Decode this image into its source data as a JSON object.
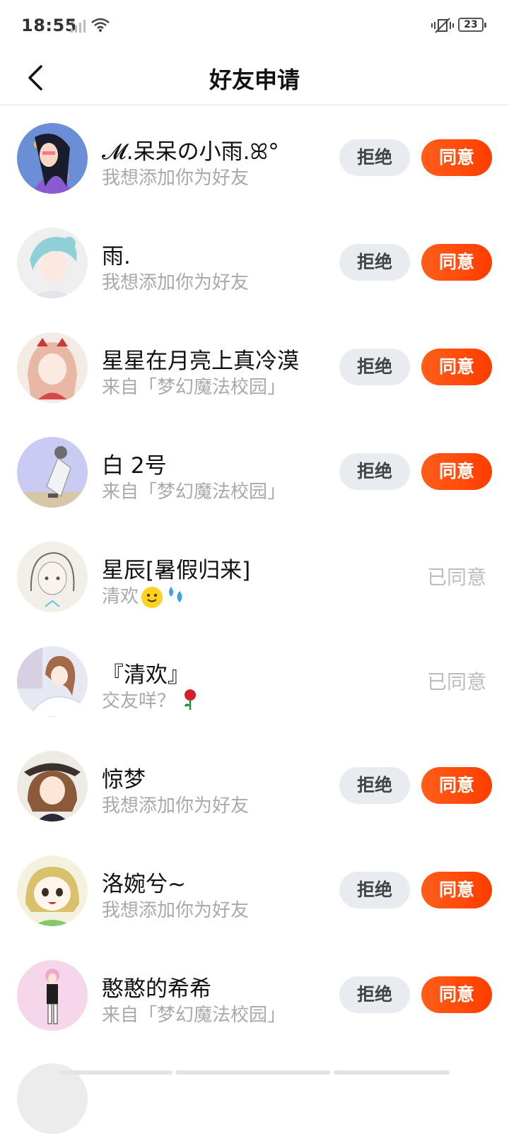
{
  "status": {
    "time": "18:55",
    "battery": "23"
  },
  "nav": {
    "title": "好友申请"
  },
  "buttons": {
    "reject": "拒绝",
    "agree": "同意",
    "agreed": "已同意"
  },
  "requests": [
    {
      "name": "𝓜.呆呆の小雨.ꕤ°",
      "message": "我想添加你为好友",
      "state": "pending",
      "avatar": "avatar-girl-dark-hair"
    },
    {
      "name": "雨.",
      "message": "我想添加你为好友",
      "state": "pending",
      "avatar": "avatar-boy-blue-hair"
    },
    {
      "name": "星星在月亮上真冷漠",
      "message": "来自「梦幻魔法校园」",
      "state": "pending",
      "avatar": "avatar-girl-bows"
    },
    {
      "name": "白 2号",
      "message": "来自「梦幻魔法校园」",
      "state": "pending",
      "avatar": "avatar-figure-sitting"
    },
    {
      "name": "星辰[暑假归来]",
      "message": "清欢",
      "state": "agreed",
      "avatar": "avatar-girl-sketch"
    },
    {
      "name": "『清欢』",
      "message": "交友咩？",
      "state": "agreed",
      "avatar": "avatar-girl-scene"
    },
    {
      "name": "惊梦",
      "message": "我想添加你为好友",
      "state": "pending",
      "avatar": "avatar-girl-hat"
    },
    {
      "name": "洛婉兮~",
      "message": "我想添加你为好友",
      "state": "pending",
      "avatar": "avatar-cartoon-girl"
    },
    {
      "name": "憨憨的希希",
      "message": "来自「梦幻魔法校园」",
      "state": "pending",
      "avatar": "avatar-girl-pink"
    }
  ],
  "colors": {
    "accent": "#ff4d12",
    "reject_bg": "#e8ecf1",
    "muted_text": "#a9a9a9",
    "agreed_text": "#bdbdbd"
  }
}
